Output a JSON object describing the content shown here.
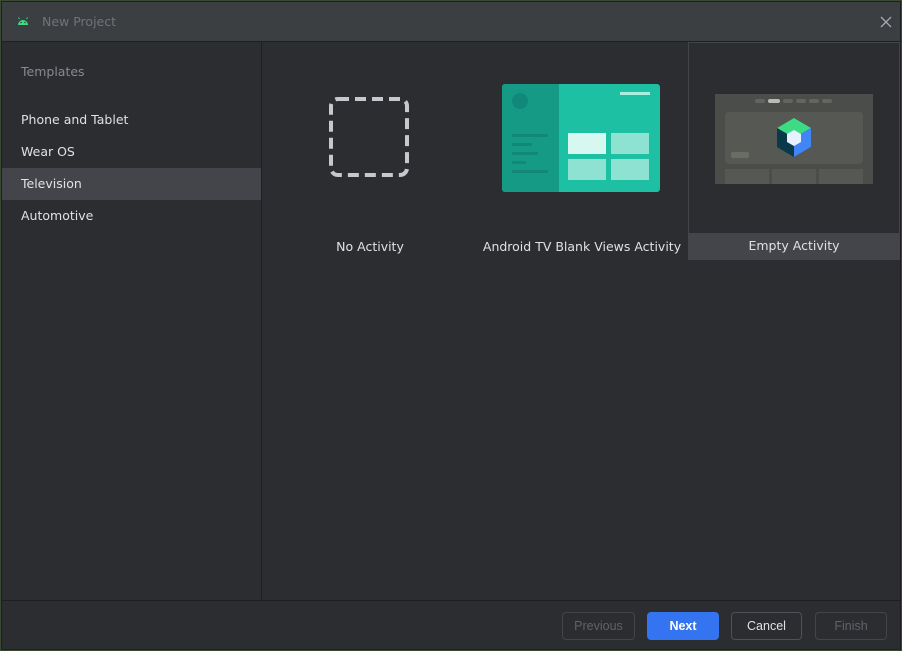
{
  "window": {
    "title": "New Project"
  },
  "sidebar": {
    "heading": "Templates",
    "items": [
      {
        "label": "Phone and Tablet"
      },
      {
        "label": "Wear OS"
      },
      {
        "label": "Television",
        "selected": true
      },
      {
        "label": "Automotive"
      }
    ]
  },
  "templates": [
    {
      "label": "No Activity",
      "icon": "dashed-empty-icon"
    },
    {
      "label": "Android TV Blank Views Activity",
      "icon": "tv-blank-views-thumbnail"
    },
    {
      "label": "Empty Activity",
      "icon": "compose-empty-activity-thumbnail",
      "selected": true
    }
  ],
  "footer": {
    "previous_label": "Previous",
    "next_label": "Next",
    "cancel_label": "Cancel",
    "finish_label": "Finish"
  },
  "colors": {
    "accent": "#3574f0",
    "teal": "#1ec0a3",
    "android_green": "#3ddc84",
    "selected_bg": "#43454a"
  }
}
